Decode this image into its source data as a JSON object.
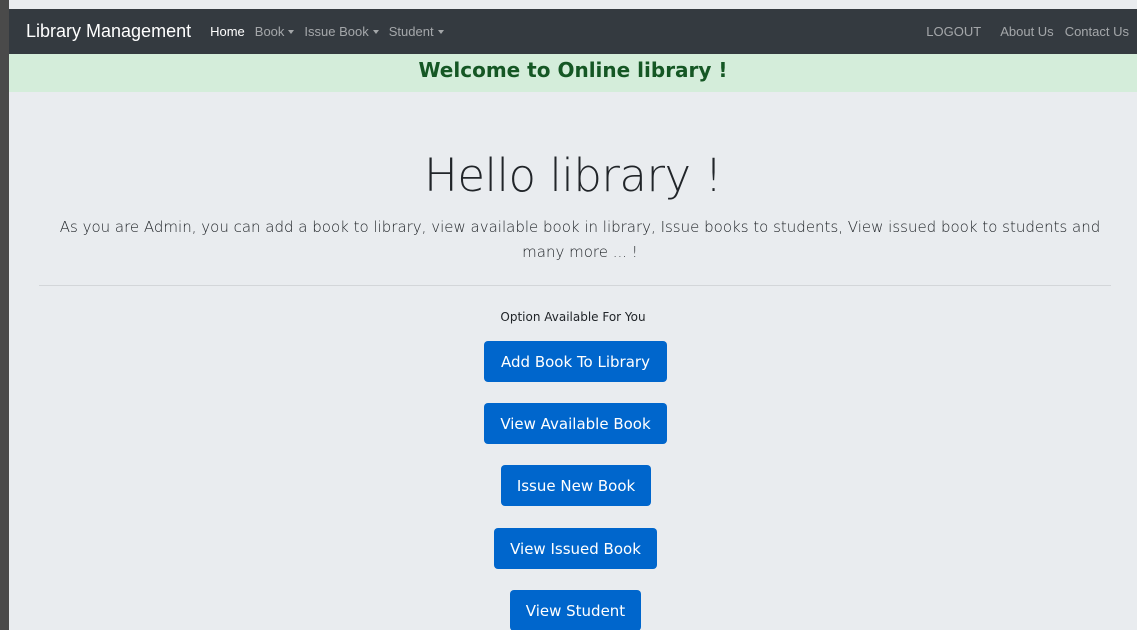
{
  "navbar": {
    "brand": "Library Management",
    "items": [
      {
        "label": "Home",
        "active": true,
        "dropdown": false
      },
      {
        "label": "Book",
        "active": false,
        "dropdown": true
      },
      {
        "label": "Issue Book",
        "active": false,
        "dropdown": true
      },
      {
        "label": "Student",
        "active": false,
        "dropdown": true
      }
    ],
    "right_items": [
      {
        "label": "LOGOUT"
      },
      {
        "label": "About Us"
      },
      {
        "label": "Contact Us"
      }
    ]
  },
  "alert": {
    "text": "Welcome to Online library !"
  },
  "jumbotron": {
    "heading": "Hello library !",
    "lead": "As you are Admin, you can add a book to library, view available book in library, Issue books to students, View issued book to students and many more ... !",
    "options_label": "Option Available For You",
    "buttons": [
      {
        "label": "Add Book To Library"
      },
      {
        "label": "View Available Book"
      },
      {
        "label": "Issue New Book"
      },
      {
        "label": "View Issued Book"
      },
      {
        "label": "View Student"
      }
    ]
  },
  "colors": {
    "navbar_bg": "#343a40",
    "alert_bg": "#d4edda",
    "alert_text": "#155724",
    "page_bg": "#e9ecef",
    "button_bg": "#0066cc"
  }
}
